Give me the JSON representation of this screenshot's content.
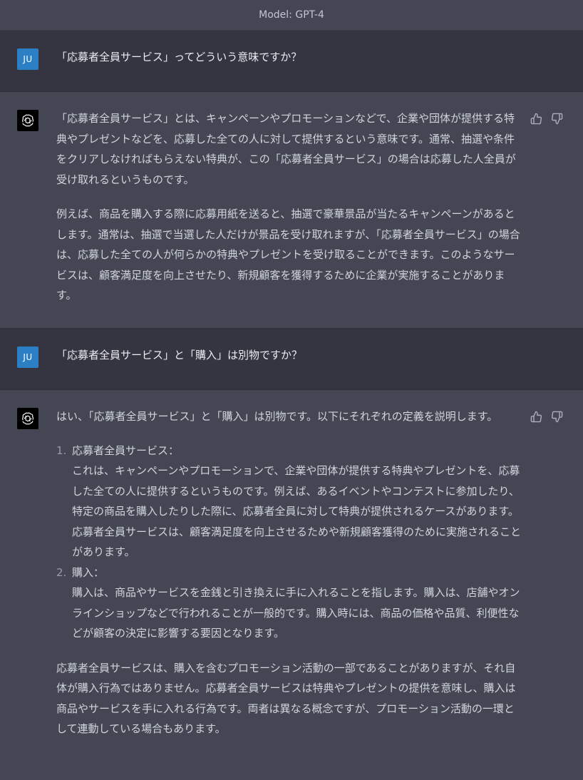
{
  "header": {
    "model_label": "Model: GPT-4"
  },
  "user_avatar": "JU",
  "messages": [
    {
      "role": "user",
      "text": "「応募者全員サービス」ってどういう意味ですか？"
    },
    {
      "role": "assistant",
      "paragraphs": [
        "「応募者全員サービス」とは、キャンペーンやプロモーションなどで、企業や団体が提供する特典やプレゼントなどを、応募した全ての人に対して提供するという意味です。通常、抽選や条件をクリアしなければもらえない特典が、この「応募者全員サービス」の場合は応募した人全員が受け取れるというものです。",
        "例えば、商品を購入する際に応募用紙を送ると、抽選で豪華景品が当たるキャンペーンがあるとします。通常は、抽選で当選した人だけが景品を受け取れますが、「応募者全員サービス」の場合は、応募した全ての人が何らかの特典やプレゼントを受け取ることができます。このようなサービスは、顧客満足度を向上させたり、新規顧客を獲得するために企業が実施することがあります。"
      ]
    },
    {
      "role": "user",
      "text": "「応募者全員サービス」と「購入」は別物ですか？"
    },
    {
      "role": "assistant",
      "intro": "はい、「応募者全員サービス」と「購入」は別物です。以下にそれぞれの定義を説明します。",
      "list": [
        {
          "num": "1.",
          "title": "応募者全員サービス：",
          "desc": "これは、キャンペーンやプロモーションで、企業や団体が提供する特典やプレゼントを、応募した全ての人に提供するというものです。例えば、あるイベントやコンテストに参加したり、特定の商品を購入したりした際に、応募者全員に対して特典が提供されるケースがあります。応募者全員サービスは、顧客満足度を向上させるためや新規顧客獲得のために実施されることがあります。"
        },
        {
          "num": "2.",
          "title": "購入：",
          "desc": "購入は、商品やサービスを金銭と引き換えに手に入れることを指します。購入は、店舗やオンラインショップなどで行われることが一般的です。購入時には、商品の価格や品質、利便性などが顧客の決定に影響する要因となります。"
        }
      ],
      "outro": "応募者全員サービスは、購入を含むプロモーション活動の一部であることがありますが、それ自体が購入行為ではありません。応募者全員サービスは特典やプレゼントの提供を意味し、購入は商品やサービスを手に入れる行為です。両者は異なる概念ですが、プロモーション活動の一環として連動している場合もあります。"
    }
  ],
  "icons": {
    "assistant_avatar": "openai-logo-icon",
    "like": "thumbs-up-icon",
    "dislike": "thumbs-down-icon"
  },
  "colors": {
    "user_bg": "#343541",
    "assistant_bg": "#444654",
    "user_avatar_bg": "#2b80c5"
  }
}
